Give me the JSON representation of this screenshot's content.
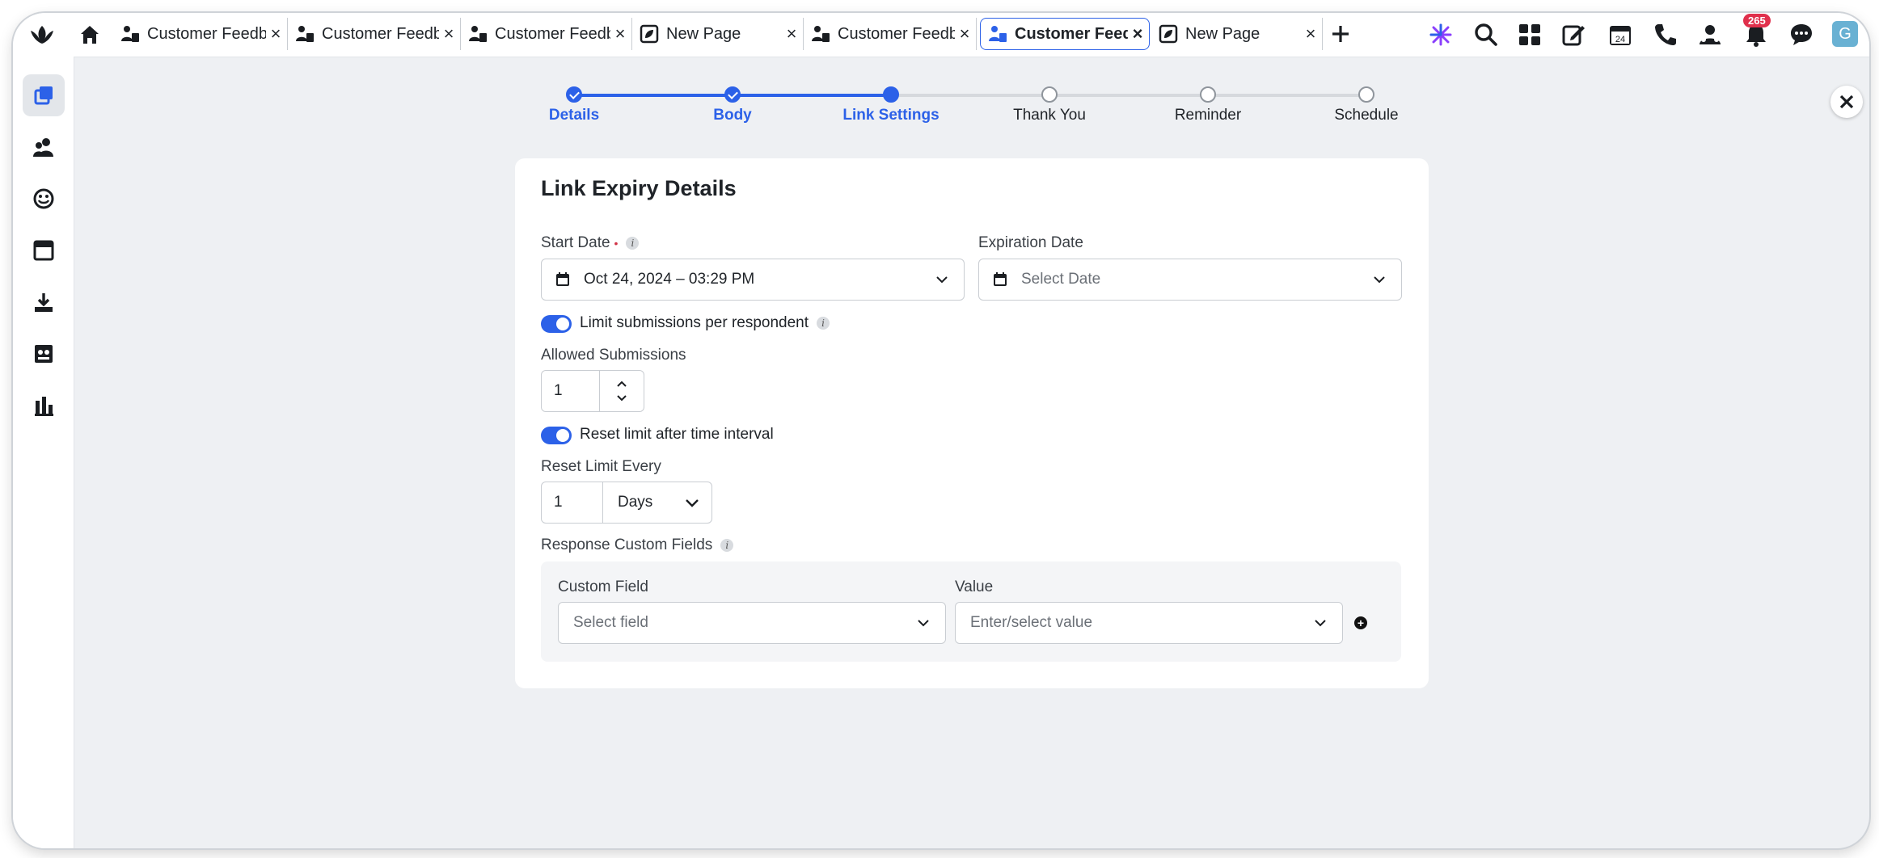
{
  "tabs": [
    {
      "label": "Customer Feedback",
      "icon": "survey-person-icon",
      "active": false
    },
    {
      "label": "Customer Feedback",
      "icon": "survey-person-icon",
      "active": false
    },
    {
      "label": "Customer Feedback",
      "icon": "survey-person-icon",
      "active": false
    },
    {
      "label": "New Page",
      "icon": "page-leaf-icon",
      "active": false
    },
    {
      "label": "Customer Feedback",
      "icon": "survey-person-icon",
      "active": false
    },
    {
      "label": "Customer Feedback",
      "icon": "survey-person-icon",
      "active": true
    },
    {
      "label": "New Page",
      "icon": "page-leaf-icon",
      "active": false
    }
  ],
  "header": {
    "notifications_count": "265",
    "avatar_initial": "G",
    "calendar_day": "24"
  },
  "stepper": {
    "steps": [
      {
        "label": "Details",
        "state": "done"
      },
      {
        "label": "Body",
        "state": "done"
      },
      {
        "label": "Link Settings",
        "state": "current"
      },
      {
        "label": "Thank You",
        "state": "todo"
      },
      {
        "label": "Reminder",
        "state": "todo"
      },
      {
        "label": "Schedule",
        "state": "todo"
      }
    ]
  },
  "form": {
    "title": "Link Expiry Details",
    "start_date_label": "Start Date",
    "start_date_value": "Oct 24, 2024 – 03:29 PM",
    "expiration_label": "Expiration Date",
    "expiration_placeholder": "Select Date",
    "limit_toggle_label": "Limit submissions per respondent",
    "limit_toggle_on": true,
    "allowed_label": "Allowed Submissions",
    "allowed_value": "1",
    "reset_toggle_label": "Reset limit after time interval",
    "reset_toggle_on": true,
    "reset_every_label": "Reset Limit Every",
    "reset_every_value": "1",
    "reset_every_unit": "Days",
    "custom_fields_label": "Response Custom Fields",
    "custom_field_col": "Custom Field",
    "custom_field_placeholder": "Select field",
    "value_col": "Value",
    "value_placeholder": "Enter/select value"
  },
  "colors": {
    "accent": "#2c61e8",
    "required": "#d13447",
    "badge": "#e0304c"
  }
}
